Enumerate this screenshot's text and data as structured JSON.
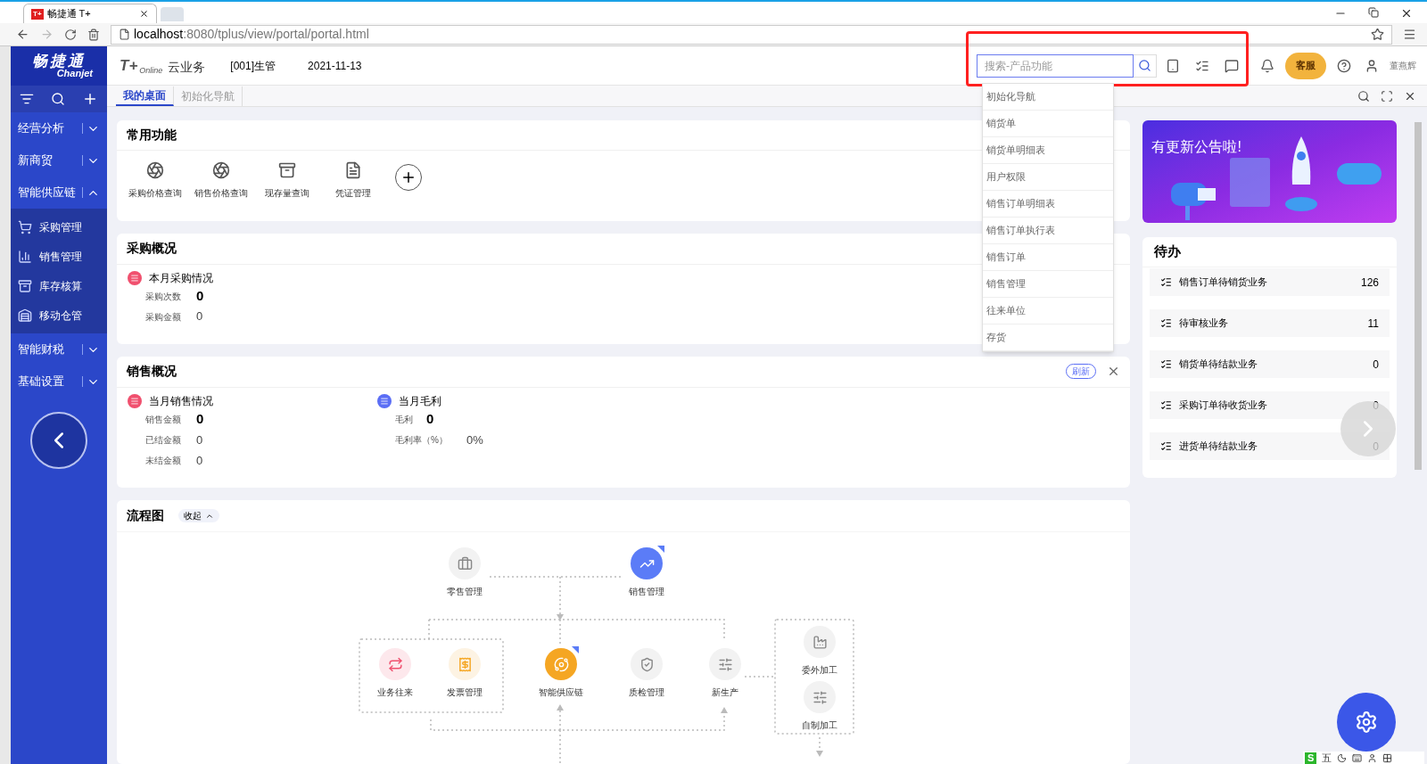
{
  "browser": {
    "tab_icon": "T+",
    "tab_title": "畅捷通 T+",
    "url_host": "localhost",
    "url_path": ":8080/tplus/view/portal/portal.html"
  },
  "header": {
    "logo_cn": "畅捷通",
    "logo_en": "Chanjet",
    "product_mark": "T+",
    "product_sub": "Online",
    "product": "云业务",
    "account": "[001]生管",
    "date": "2021-11-13",
    "search_placeholder": "搜索-产品功能",
    "service_badge": "客服",
    "user_name": "董燕辉"
  },
  "page_tabs": [
    {
      "label": "我的桌面",
      "selected": true
    },
    {
      "label": "初始化导航",
      "selected": false
    }
  ],
  "sidebar": {
    "items": [
      {
        "label": "经营分析",
        "expanded": false
      },
      {
        "label": "新商贸",
        "expanded": false
      },
      {
        "label": "智能供应链",
        "expanded": true,
        "children": [
          {
            "label": "采购管理"
          },
          {
            "label": "销售管理"
          },
          {
            "label": "库存核算"
          },
          {
            "label": "移动仓管"
          }
        ]
      },
      {
        "label": "智能财税",
        "expanded": false
      },
      {
        "label": "基础设置",
        "expanded": false
      }
    ]
  },
  "search_dropdown": {
    "items": [
      "初始化导航",
      "销货单",
      "销货单明细表",
      "用户权限",
      "销售订单明细表",
      "销售订单执行表",
      "销售订单",
      "销售管理",
      "往来单位",
      "存货"
    ]
  },
  "frequent": {
    "title": "常用功能",
    "items": [
      "采购价格查询",
      "销售价格查询",
      "现存量查询",
      "凭证管理"
    ]
  },
  "purchase": {
    "title": "采购概况",
    "section": "本月采购情况",
    "rows": [
      {
        "label": "采购次数",
        "value": "0",
        "bold": true
      },
      {
        "label": "采购金额",
        "value": "0",
        "bold": false
      }
    ]
  },
  "sales": {
    "title": "销售概况",
    "refresh": "刷新",
    "groups": [
      {
        "title": "当月销售情况",
        "color": "#f0506e",
        "rows": [
          {
            "label": "销售金额",
            "value": "0",
            "bold": true
          },
          {
            "label": "已结金额",
            "value": "0",
            "bold": false
          },
          {
            "label": "未结金额",
            "value": "0",
            "bold": false
          }
        ]
      },
      {
        "title": "当月毛利",
        "color": "#5b6ef5",
        "rows": [
          {
            "label": "毛利",
            "value": "0",
            "bold": true
          },
          {
            "label": "毛利率（%）",
            "value": "0%",
            "bold": false
          }
        ]
      }
    ]
  },
  "flow": {
    "title": "流程图",
    "collapse": "收起",
    "nodes": [
      {
        "label": "零售管理",
        "color": "#f2f2f2",
        "flag": false
      },
      {
        "label": "销售管理",
        "color": "#5b7cf7",
        "flag": true
      },
      {
        "label": "业务往来",
        "color": "#fde8ec",
        "flag": false
      },
      {
        "label": "发票管理",
        "color": "#fdf3e3",
        "flag": false
      },
      {
        "label": "智能供应链",
        "color": "#f5a623",
        "flag": true
      },
      {
        "label": "质检管理",
        "color": "#f2f2f2",
        "flag": false
      },
      {
        "label": "新生产",
        "color": "#f2f2f2",
        "flag": false
      },
      {
        "label": "委外加工",
        "color": "#f2f2f2",
        "flag": false
      },
      {
        "label": "自制加工",
        "color": "#f2f2f2",
        "flag": false
      }
    ]
  },
  "banner": {
    "text": "有更新公告啦!"
  },
  "todo": {
    "title": "待办",
    "items": [
      {
        "label": "销售订单待销货业务",
        "count": "126"
      },
      {
        "label": "待审核业务",
        "count": "11"
      },
      {
        "label": "销货单待结款业务",
        "count": "0"
      },
      {
        "label": "采购订单待收货业务",
        "count": "0"
      },
      {
        "label": "进货单待结款业务",
        "count": "0"
      }
    ]
  },
  "ime": {
    "logo": "S",
    "mode": "五"
  }
}
